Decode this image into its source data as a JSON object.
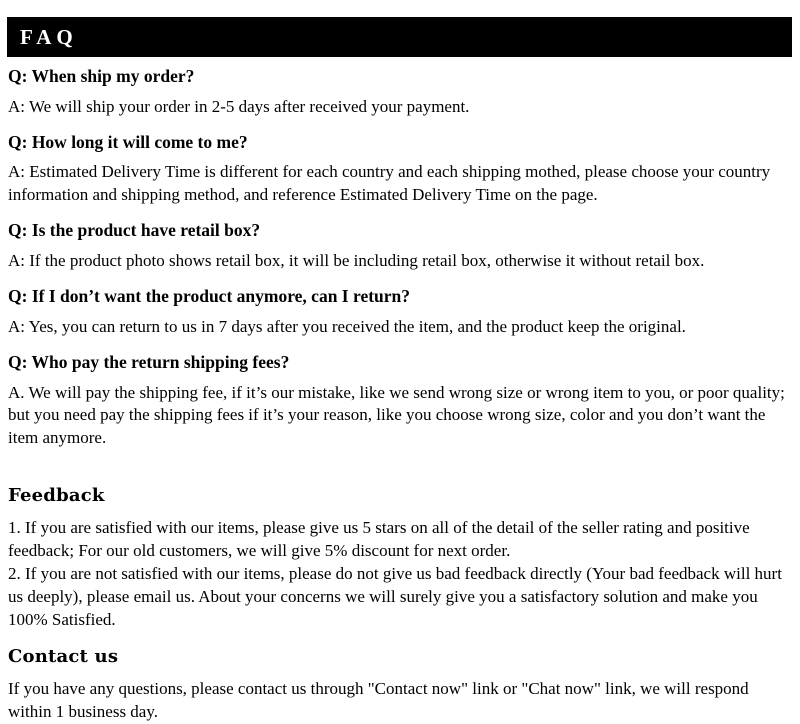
{
  "banner": {
    "title": "FAQ"
  },
  "faq": {
    "items": [
      {
        "question": "Q: When ship my order?",
        "answer": "A: We will ship your order in 2-5 days after received your payment."
      },
      {
        "question": "Q: How long it will come to me?",
        "answer": "A: Estimated Delivery Time is different for each country and each shipping mothed, please choose your country information and shipping method, and reference Estimated Delivery Time on the page."
      },
      {
        "question": "Q: Is the product have retail box?",
        "answer": "A: If  the product photo shows retail box, it will be including retail box, otherwise it without retail box."
      },
      {
        "question": "Q: If  I don’t want the product anymore, can I return?",
        "answer": "A: Yes, you can return to us in 7 days after you received the item, and the product keep the original."
      },
      {
        "question": "Q: Who pay the return shipping fees?",
        "answer": "A.  We will pay the shipping fee, if  it’s our mistake, like we send wrong size or wrong item to you, or poor quality; but you need pay the shipping fees if  it’s your reason, like you choose wrong size, color and you don’t want the item anymore."
      }
    ]
  },
  "feedback": {
    "heading": "Feedback",
    "item_1": "1.  If you are satisfied with our items, please give us 5 stars on all of the detail of the seller rating and positive feedback; For our old customers, we will give 5% discount for next order.",
    "item_2": "2.  If you are not satisfied with our items, please do not give us bad feedback directly (Your bad feedback will hurt us deeply), please email us. About your concerns we will surely give you a satisfactory solution and make you 100% Satisfied."
  },
  "contact": {
    "heading": "Contact us",
    "body": "If you have any questions, please contact us through \"Contact now\" link or \"Chat now\" link, we will respond within 1 business day."
  },
  "colors": {
    "banner_background": "#000000",
    "banner_text": "#ffffff",
    "page_background": "#ffffff",
    "body_text": "#000000"
  }
}
